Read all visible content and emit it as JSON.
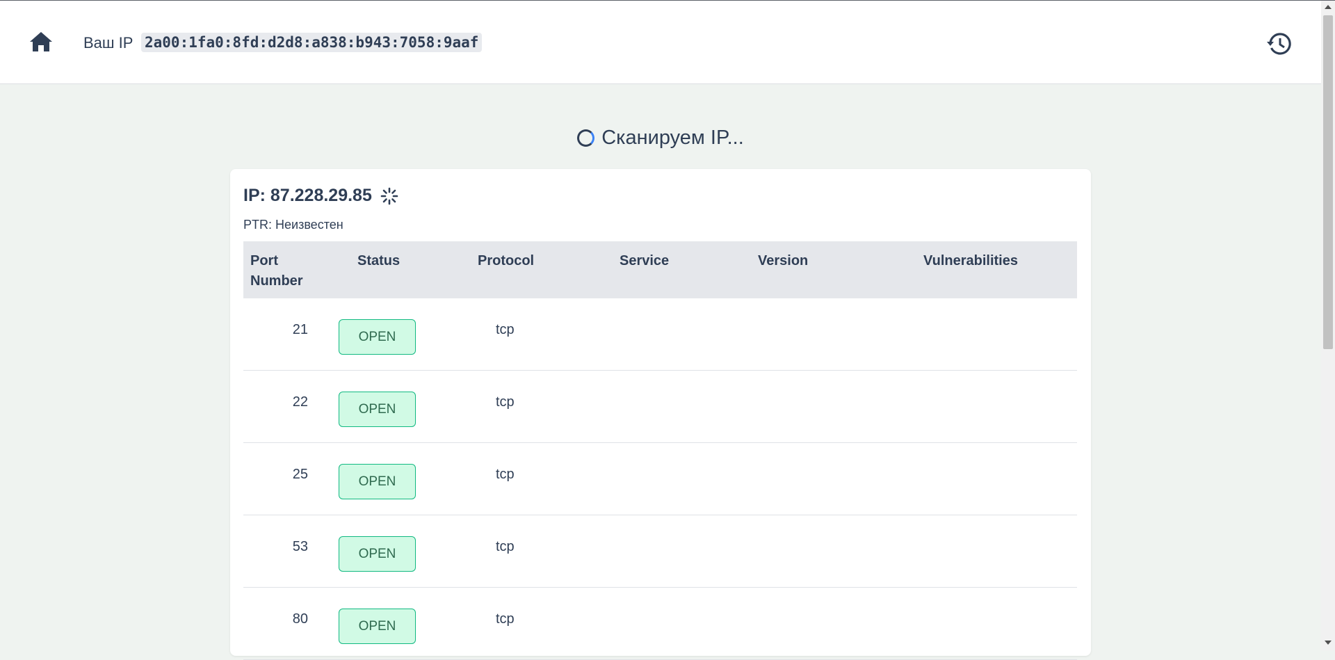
{
  "header": {
    "ip_label": "Ваш IP",
    "ip_value": "2a00:1fa0:8fd:d2d8:a838:b943:7058:9aaf",
    "home_icon": "home-icon",
    "history_icon": "history-icon"
  },
  "scan": {
    "title": "Сканируем IP..."
  },
  "card": {
    "ip_title": "IP: 87.228.29.85",
    "ptr": "PTR: Неизвестен",
    "columns": [
      "Port Number",
      "Status",
      "Protocol",
      "Service",
      "Version",
      "Vulnerabilities"
    ],
    "rows": [
      {
        "port": "21",
        "status": "OPEN",
        "protocol": "tcp"
      },
      {
        "port": "22",
        "status": "OPEN",
        "protocol": "tcp"
      },
      {
        "port": "25",
        "status": "OPEN",
        "protocol": "tcp"
      },
      {
        "port": "53",
        "status": "OPEN",
        "protocol": "tcp"
      },
      {
        "port": "80",
        "status": "OPEN",
        "protocol": "tcp"
      }
    ]
  },
  "colors": {
    "text": "#2f3e55",
    "background": "#eff3f0",
    "open_badge_bg": "#d1fae5",
    "open_badge_border": "#10b981"
  }
}
